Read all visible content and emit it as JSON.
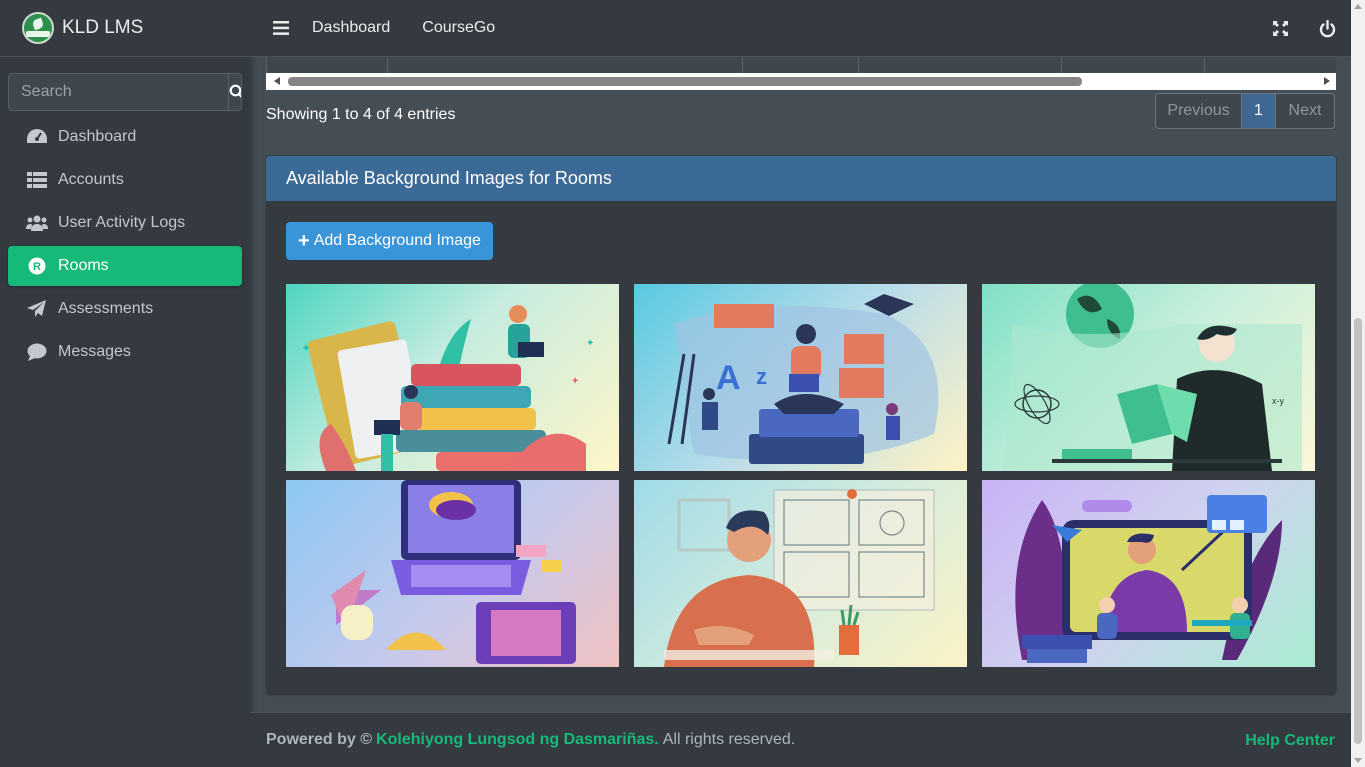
{
  "brand": {
    "name": "KLD LMS"
  },
  "search": {
    "placeholder": "Search"
  },
  "sidebar": {
    "items": [
      {
        "label": "Dashboard",
        "icon": "gauge-icon"
      },
      {
        "label": "Accounts",
        "icon": "table-icon"
      },
      {
        "label": "User Activity Logs",
        "icon": "users-icon"
      },
      {
        "label": "Rooms",
        "icon": "r-circle-icon",
        "active": true
      },
      {
        "label": "Assessments",
        "icon": "paper-plane-icon"
      },
      {
        "label": "Messages",
        "icon": "comment-icon"
      }
    ]
  },
  "topbar": {
    "links": [
      "Dashboard",
      "CourseGo"
    ],
    "icons": [
      "expand-icon",
      "power-icon"
    ]
  },
  "table": {
    "entries_text": "Showing 1 to 4 of 4 entries"
  },
  "pagination": {
    "previous": "Previous",
    "current": "1",
    "next": "Next"
  },
  "card": {
    "title": "Available Background Images for Rooms",
    "add_button": "Add Background Image"
  },
  "images": [
    {
      "name": "books-stack-illustration",
      "bg_start": "#4fd6c0",
      "bg_end": "#fff6c8"
    },
    {
      "name": "classroom-az-illustration",
      "bg_start": "#58c9e0",
      "bg_end": "#fff3c4"
    },
    {
      "name": "student-reading-illustration",
      "bg_start": "#7fe0c6",
      "bg_end": "#fdf7d6"
    },
    {
      "name": "laptop-design-tools-illustration",
      "bg_start": "#8cc8f2",
      "bg_end": "#f0c2c2"
    },
    {
      "name": "artist-storyboard-illustration",
      "bg_start": "#9fdbe8",
      "bg_end": "#fbf3c6"
    },
    {
      "name": "online-teaching-illustration",
      "bg_start": "#c9b2f5",
      "bg_end": "#a9ecd2"
    }
  ],
  "footer": {
    "powered": "Powered by ©",
    "org": "Kolehiyong Lungsod ng Dasmariñas.",
    "rights": "All rights reserved.",
    "help": "Help Center"
  },
  "colors": {
    "accent_green": "#17b978",
    "header_blue": "#3c6a97",
    "button_blue": "#3a95d8",
    "sidebar_bg": "#343a40",
    "content_bg": "#454d55"
  }
}
